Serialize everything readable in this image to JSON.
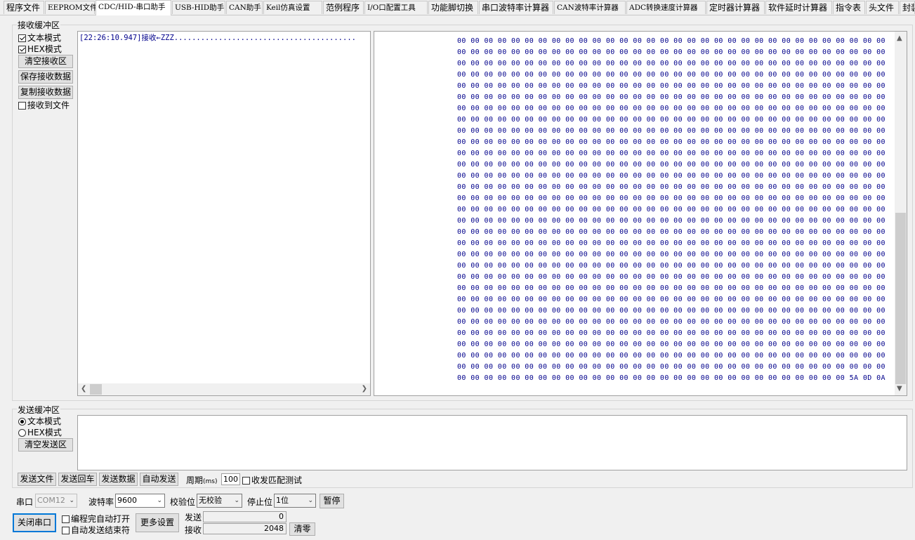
{
  "tabs": [
    {
      "label": "程序文件"
    },
    {
      "label": "EEPROM文件"
    },
    {
      "label": "CDC/HID-串口助手"
    },
    {
      "label": "USB-HID助手"
    },
    {
      "label": "CAN助手"
    },
    {
      "label": "Keil仿真设置"
    },
    {
      "label": "范例程序"
    },
    {
      "label": "I/O口配置工具"
    },
    {
      "label": "功能脚切换"
    },
    {
      "label": "串口波特率计算器"
    },
    {
      "label": "CAN波特率计算器"
    },
    {
      "label": "ADC转换速度计算器"
    },
    {
      "label": "定时器计算器"
    },
    {
      "label": "软件延时计算器"
    },
    {
      "label": "指令表"
    },
    {
      "label": "头文件"
    },
    {
      "label": "封装"
    }
  ],
  "active_tab": "CDC/HID-串口助手",
  "receive": {
    "group_label": "接收缓冲区",
    "text_mode_label": "文本模式",
    "text_mode_checked": true,
    "hex_mode_label": "HEX模式",
    "hex_mode_checked": true,
    "clear_label": "清空接收区",
    "save_label": "保存接收数据",
    "copy_label": "复制接收数据",
    "to_file_label": "接收到文件",
    "to_file_checked": false,
    "text_line": "[22:26:10.947]接收←ZZZ.........................................",
    "hex_row_normal": "00 00 00 00 00 00 00 00 00 00 00 00 00 00 00 00 00 00 00 00 00 00 00 00 00 00 00 00 00 00 00 00",
    "hex_row_last": "00 00 00 00 00 00 00 00 00 00 00 00 00 00 00 00 00 00 00 00 00 00 00 00 00 00 00 00 00 5A 0D 0A",
    "hex_visible_rows": 32
  },
  "send": {
    "group_label": "发送缓冲区",
    "text_mode_label": "文本模式",
    "text_mode_selected": true,
    "hex_mode_label": "HEX模式",
    "clear_label": "清空发送区",
    "send_file_label": "发送文件",
    "send_return_label": "发送回车",
    "send_data_label": "发送数据",
    "auto_send_label": "自动发送",
    "period_label": "周期",
    "period_unit": "(ms)",
    "period_value": "100",
    "match_test_label": "收发匹配测试",
    "match_test_checked": false
  },
  "serial": {
    "port_label": "串口",
    "port_value": "COM12",
    "baud_label": "波特率",
    "baud_value": "9600",
    "parity_label": "校验位",
    "parity_value": "无校验",
    "stop_label": "停止位",
    "stop_value": "1位",
    "pause_label": "暂停",
    "close_label": "关闭串口",
    "auto_open_label": "编程完自动打开",
    "auto_send_end_label": "自动发送结束符",
    "more_label": "更多设置",
    "sent_label": "发送",
    "sent_count": "0",
    "recv_label": "接收",
    "recv_count": "2048",
    "zero_label": "清零"
  }
}
